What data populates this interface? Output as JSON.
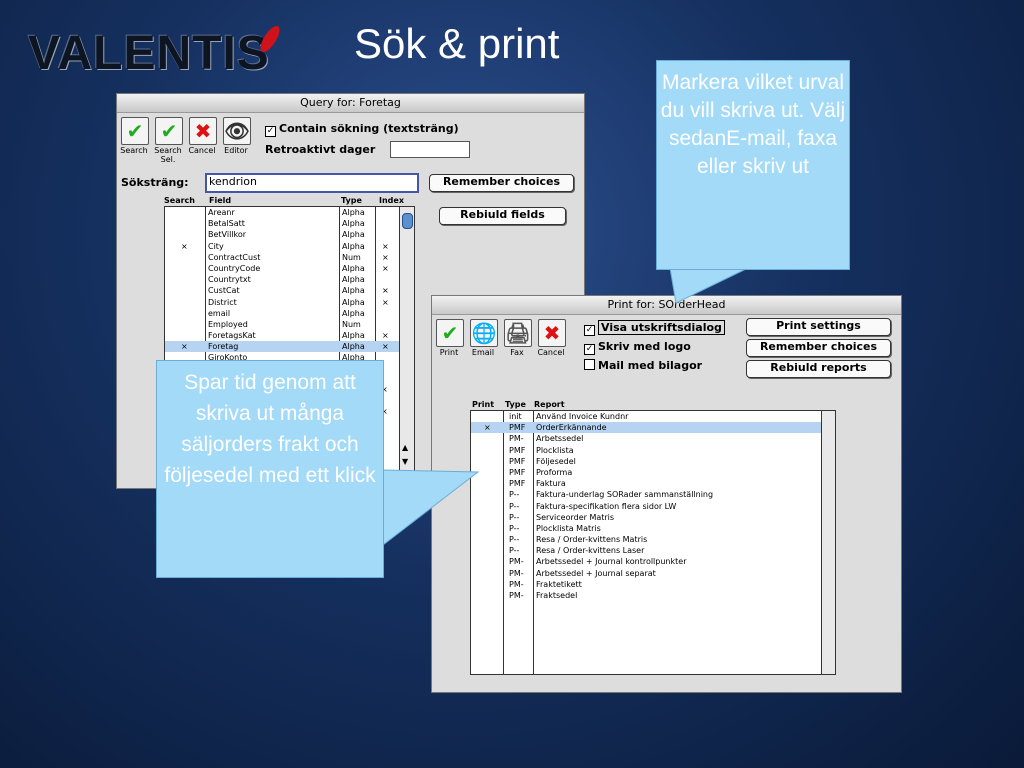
{
  "logo": {
    "text": "VALENTIS"
  },
  "slide_title": "Sök & print",
  "query_window": {
    "title": "Query for:  Foretag",
    "toolbar": [
      {
        "label": "Search",
        "glyph": "✔",
        "color": "#22aa22"
      },
      {
        "label": "Search Sel.",
        "glyph": "✔",
        "color": "#22aa22"
      },
      {
        "label": "Cancel",
        "glyph": "✖",
        "color": "#dd1111"
      },
      {
        "label": "Editor",
        "glyph": "👁",
        "color": "#333333"
      }
    ],
    "contain_label": "Contain sökning (textsträng)",
    "contain_checked": "✓",
    "retro_label": "Retroaktivt dager",
    "retro_value": "",
    "search_label": "Söksträng:",
    "search_value": "kendrion",
    "remember_button": "Remember choices",
    "rebuild_button": "Rebiuld fields",
    "columns": {
      "search": "Search",
      "field": "Field",
      "type": "Type",
      "index": "Index"
    },
    "rows": [
      {
        "search": "",
        "field": "Areanr",
        "type": "Alpha",
        "index": ""
      },
      {
        "search": "",
        "field": "BetalSatt",
        "type": "Alpha",
        "index": ""
      },
      {
        "search": "",
        "field": "BetVillkor",
        "type": "Alpha",
        "index": ""
      },
      {
        "search": "×",
        "field": "City",
        "type": "Alpha",
        "index": "×"
      },
      {
        "search": "",
        "field": "ContractCust",
        "type": "Num",
        "index": "×"
      },
      {
        "search": "",
        "field": "CountryCode",
        "type": "Alpha",
        "index": "×"
      },
      {
        "search": "",
        "field": "Countrytxt",
        "type": "Alpha",
        "index": ""
      },
      {
        "search": "",
        "field": "CustCat",
        "type": "Alpha",
        "index": "×"
      },
      {
        "search": "",
        "field": "District",
        "type": "Alpha",
        "index": "×"
      },
      {
        "search": "",
        "field": "email",
        "type": "Alpha",
        "index": ""
      },
      {
        "search": "",
        "field": "Employed",
        "type": "Num",
        "index": ""
      },
      {
        "search": "",
        "field": "ForetagsKat",
        "type": "Alpha",
        "index": "×"
      },
      {
        "search": "×",
        "field": "Foretag",
        "type": "Alpha",
        "index": "×"
      },
      {
        "search": "",
        "field": "GiroKonto",
        "type": "Alpha",
        "index": ""
      }
    ],
    "partial_index_marks": [
      "×",
      "×"
    ]
  },
  "print_window": {
    "title": "Print for:  SOrderHead",
    "toolbar": [
      {
        "label": "Print",
        "glyph": "✔",
        "color": "#22aa22"
      },
      {
        "label": "Email",
        "glyph": "🌐",
        "color": "#2266aa"
      },
      {
        "label": "Fax",
        "glyph": "🖨",
        "color": "#555555"
      },
      {
        "label": "Cancel",
        "glyph": "✖",
        "color": "#dd1111"
      }
    ],
    "options": [
      {
        "label": "Visa utskriftsdialog",
        "checked": "✓"
      },
      {
        "label": "Skriv med logo",
        "checked": "✓"
      },
      {
        "label": "Mail med bilagor",
        "checked": ""
      }
    ],
    "buttons": [
      "Print settings",
      "Remember choices",
      "Rebiuld reports"
    ],
    "columns": {
      "print": "Print",
      "type": "Type",
      "report": "Report"
    },
    "rows": [
      {
        "print": "",
        "type": "init",
        "report": "Använd Invoice Kundnr"
      },
      {
        "print": "×",
        "type": "PMF",
        "report": "OrderErkännande"
      },
      {
        "print": "",
        "type": "PM-",
        "report": "Arbetssedel"
      },
      {
        "print": "",
        "type": "PMF",
        "report": "Plocklista"
      },
      {
        "print": "",
        "type": "PMF",
        "report": "Följesedel"
      },
      {
        "print": "",
        "type": "PMF",
        "report": "Proforma"
      },
      {
        "print": "",
        "type": "PMF",
        "report": "Faktura"
      },
      {
        "print": "",
        "type": "P--",
        "report": "Faktura-underlag SORader sammanställning"
      },
      {
        "print": "",
        "type": "P--",
        "report": "Faktura-specifikation flera sidor LW"
      },
      {
        "print": "",
        "type": "P--",
        "report": "Serviceorder Matris"
      },
      {
        "print": "",
        "type": "P--",
        "report": "Plocklista Matris"
      },
      {
        "print": "",
        "type": "P--",
        "report": "Resa / Order-kvittens Matris"
      },
      {
        "print": "",
        "type": "P--",
        "report": "Resa / Order-kvittens Laser"
      },
      {
        "print": "",
        "type": "PM-",
        "report": "Arbetssedel + Journal kontrollpunkter"
      },
      {
        "print": "",
        "type": "PM-",
        "report": "Arbetssedel + Journal separat"
      },
      {
        "print": "",
        "type": "PM-",
        "report": "Fraktetikett"
      },
      {
        "print": "",
        "type": "PM-",
        "report": "Fraktsedel"
      }
    ]
  },
  "callouts": {
    "top": "Markera vilket urval du vill skriva ut. Välj sedanE-mail, faxa eller skriv ut",
    "bottom": "Spar tid genom att skriva ut många säljorders frakt och följesedel med ett klick"
  }
}
